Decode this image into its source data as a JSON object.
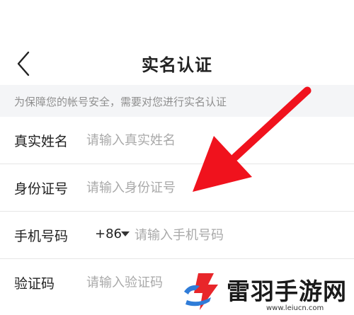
{
  "header": {
    "title": "实名认证",
    "back_icon": "chevron-left-icon"
  },
  "notice": {
    "text": "为保障您的帐号安全，需要对您进行实名认证"
  },
  "form": {
    "name": {
      "label": "真实姓名",
      "placeholder": "请输入真实姓名"
    },
    "id_number": {
      "label": "身份证号",
      "placeholder": "请输入身份证号"
    },
    "phone": {
      "label": "手机号码",
      "country_code": "+86",
      "placeholder": "请输入手机号码"
    },
    "verify_code": {
      "label": "验证码",
      "placeholder": "请输入验证码"
    }
  },
  "watermark": {
    "name": "雷羽手游网",
    "url": "www.leiucn.com",
    "logo_icon": "lightning-logo-icon"
  },
  "colors": {
    "arrow": "#f0121d",
    "notice_bg": "#f4f5f7",
    "logo_red": "#e8262a",
    "logo_blue": "#2f7cd8"
  }
}
